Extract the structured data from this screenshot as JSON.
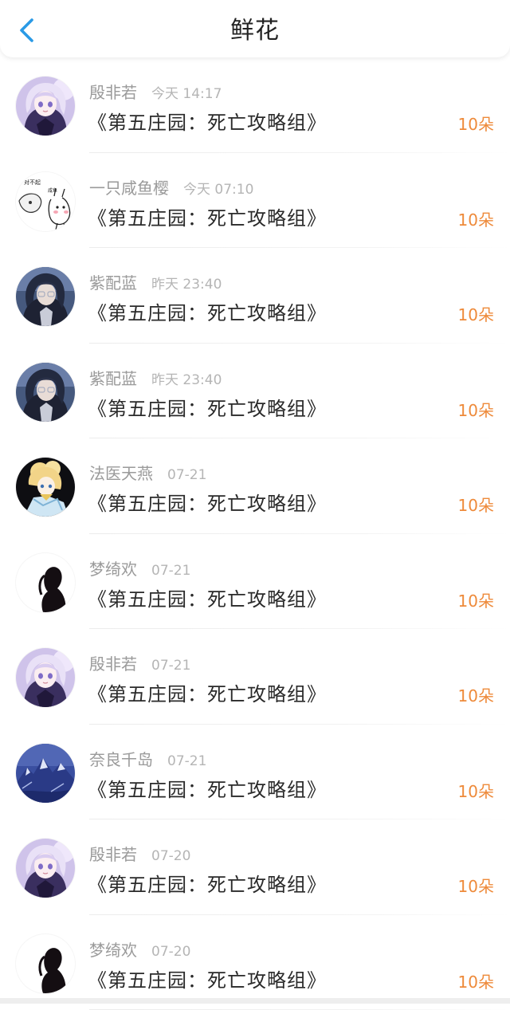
{
  "header": {
    "title": "鲜花",
    "back_icon": "chevron-left-icon",
    "accent_color": "#2a9ae6"
  },
  "colors": {
    "count": "#ee8a3a",
    "name": "#9a9a9a",
    "time": "#b5b5b5",
    "title": "#2a2a2a"
  },
  "items": [
    {
      "user": "殷非若",
      "time": "今天 14:17",
      "title": "《第五庄园：死亡攻略组》",
      "count": "10朵",
      "avatar": "anime-girl-lavender"
    },
    {
      "user": "一只咸鱼樱",
      "time": "今天 07:10",
      "title": "《第五庄园：死亡攻略组》",
      "count": "10朵",
      "avatar": "meme-sketch"
    },
    {
      "user": "紫配蓝",
      "time": "昨天 23:40",
      "title": "《第五庄园：死亡攻略组》",
      "count": "10朵",
      "avatar": "dark-hair-glasses"
    },
    {
      "user": "紫配蓝",
      "time": "昨天 23:40",
      "title": "《第五庄园：死亡攻略组》",
      "count": "10朵",
      "avatar": "dark-hair-glasses"
    },
    {
      "user": "法医天燕",
      "time": "07-21",
      "title": "《第五庄园：死亡攻略组》",
      "count": "10朵",
      "avatar": "blonde-anime"
    },
    {
      "user": "梦绮欢",
      "time": "07-21",
      "title": "《第五庄园：死亡攻略组》",
      "count": "10朵",
      "avatar": "silhouette-sunset"
    },
    {
      "user": "殷非若",
      "time": "07-21",
      "title": "《第五庄园：死亡攻略组》",
      "count": "10朵",
      "avatar": "anime-girl-lavender"
    },
    {
      "user": "奈良千岛",
      "time": "07-21",
      "title": "《第五庄园：死亡攻略组》",
      "count": "10朵",
      "avatar": "blue-mountains"
    },
    {
      "user": "殷非若",
      "time": "07-20",
      "title": "《第五庄园：死亡攻略组》",
      "count": "10朵",
      "avatar": "anime-girl-lavender"
    },
    {
      "user": "梦绮欢",
      "time": "07-20",
      "title": "《第五庄园：死亡攻略组》",
      "count": "10朵",
      "avatar": "silhouette-sunset"
    }
  ]
}
